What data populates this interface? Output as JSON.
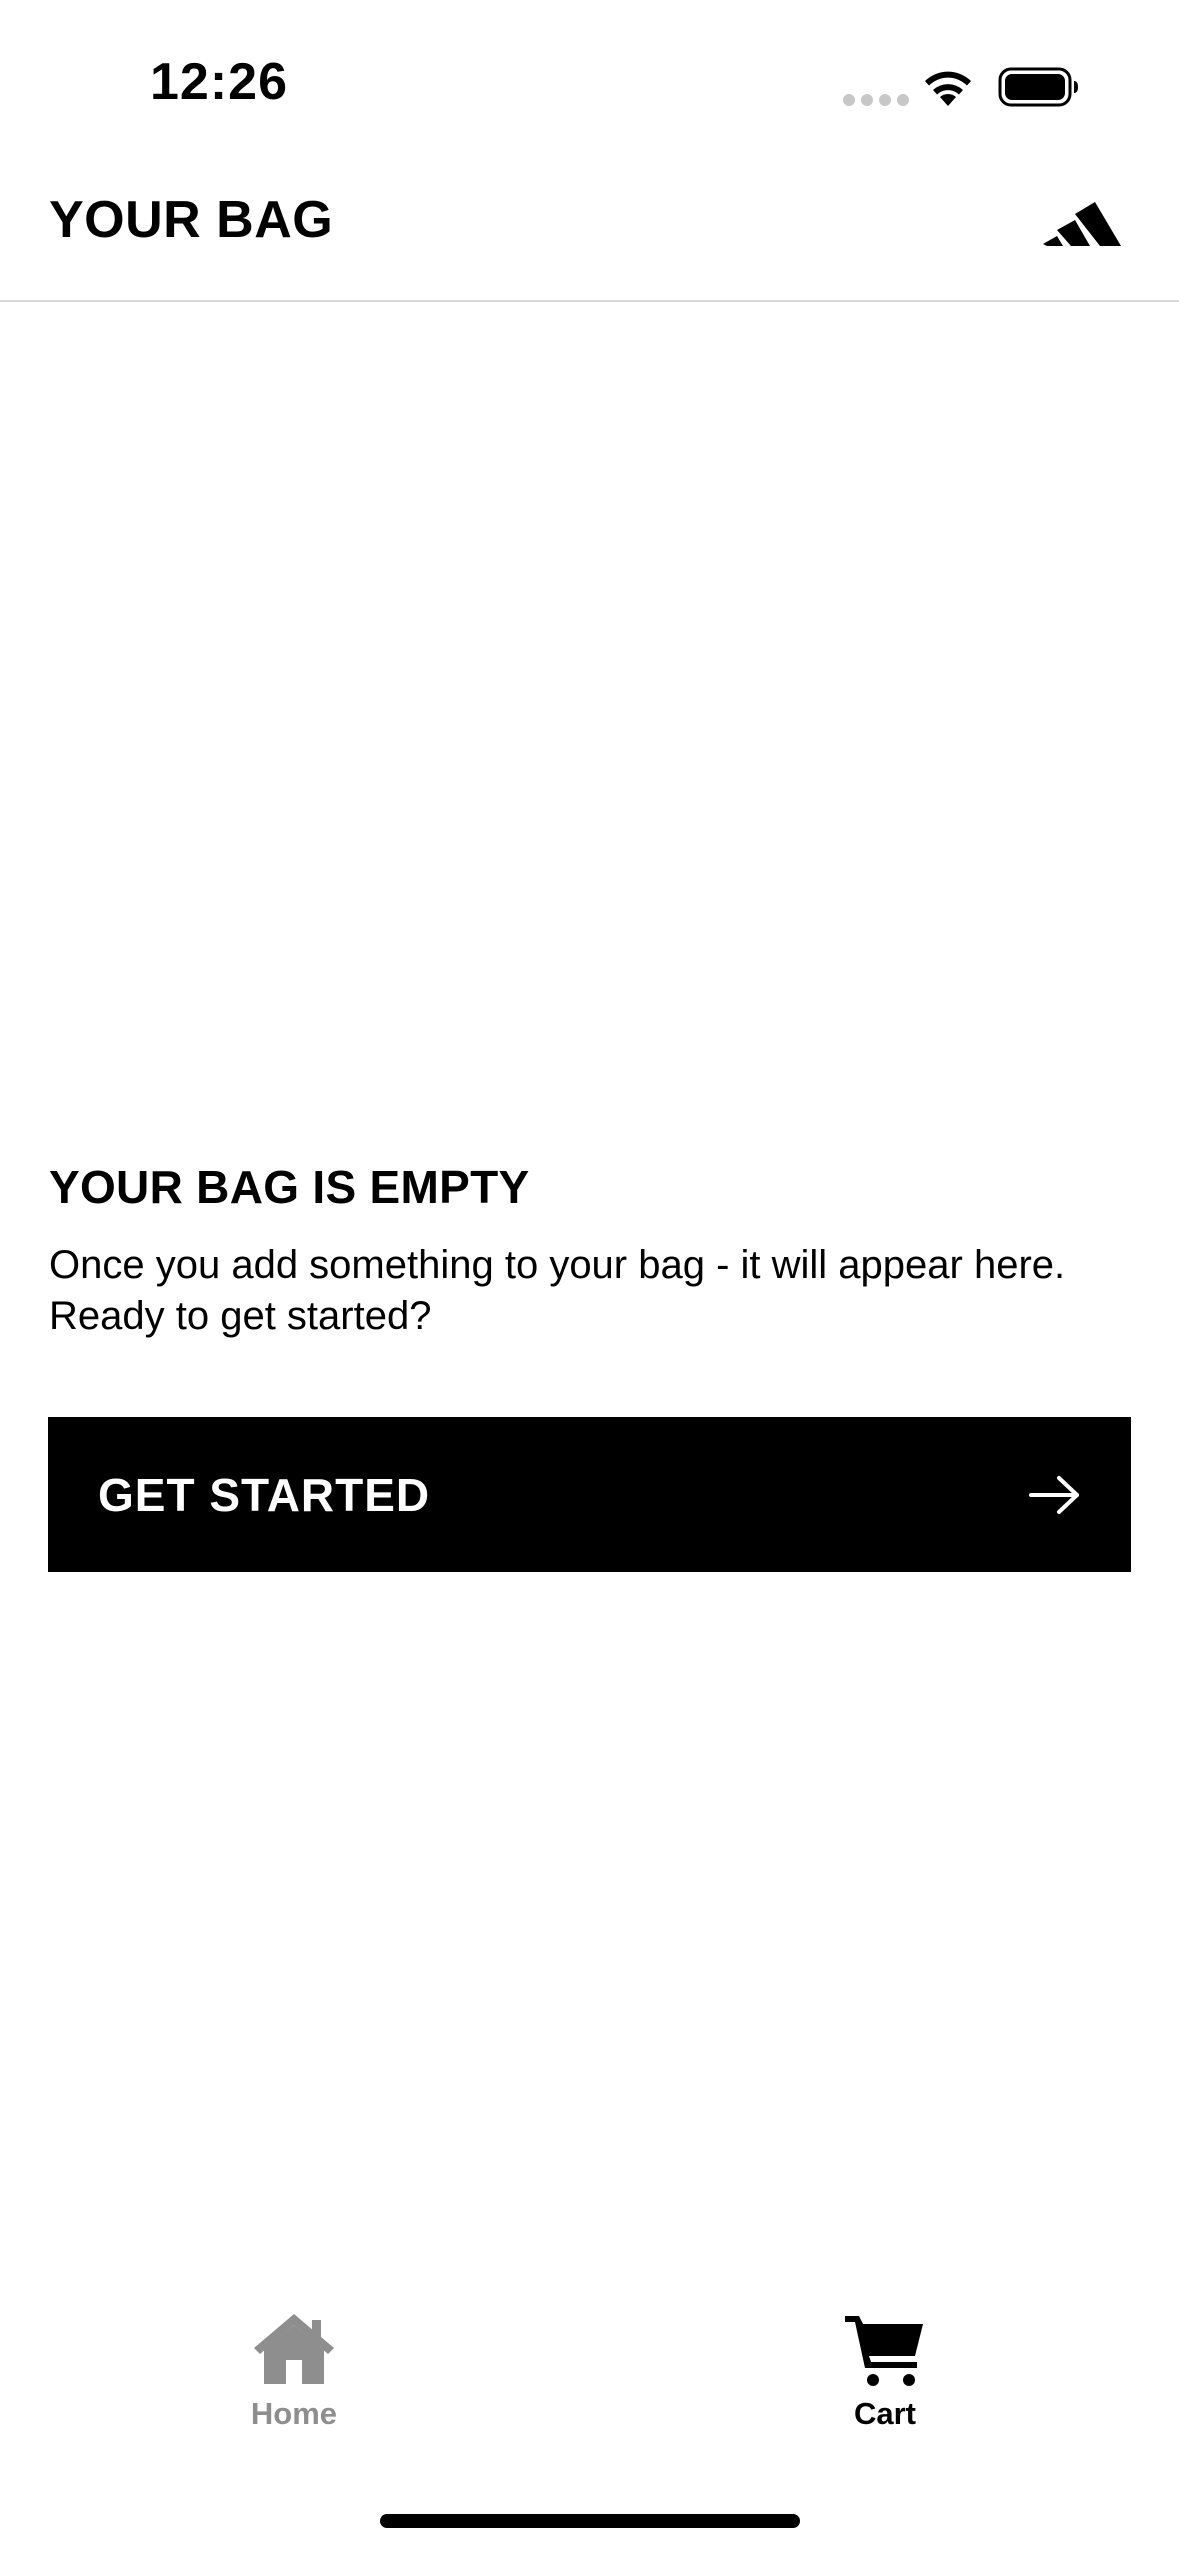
{
  "status_bar": {
    "time": "12:26"
  },
  "header": {
    "title": "YOUR BAG",
    "logo_icon": "brand-stripes-logo"
  },
  "empty_state": {
    "title": "YOUR BAG IS EMPTY",
    "description": "Once you add something to your bag - it will appear here. Ready to get started?"
  },
  "cta": {
    "label": "GET STARTED",
    "icon": "arrow-right-icon"
  },
  "tab_bar": {
    "tabs": [
      {
        "label": "Home",
        "icon": "home-icon",
        "active": false
      },
      {
        "label": "Cart",
        "icon": "cart-icon",
        "active": true
      }
    ]
  },
  "colors": {
    "primary": "#000000",
    "background": "#ffffff",
    "inactive_tab": "#8e8e8e",
    "divider": "#d9d9d9"
  }
}
